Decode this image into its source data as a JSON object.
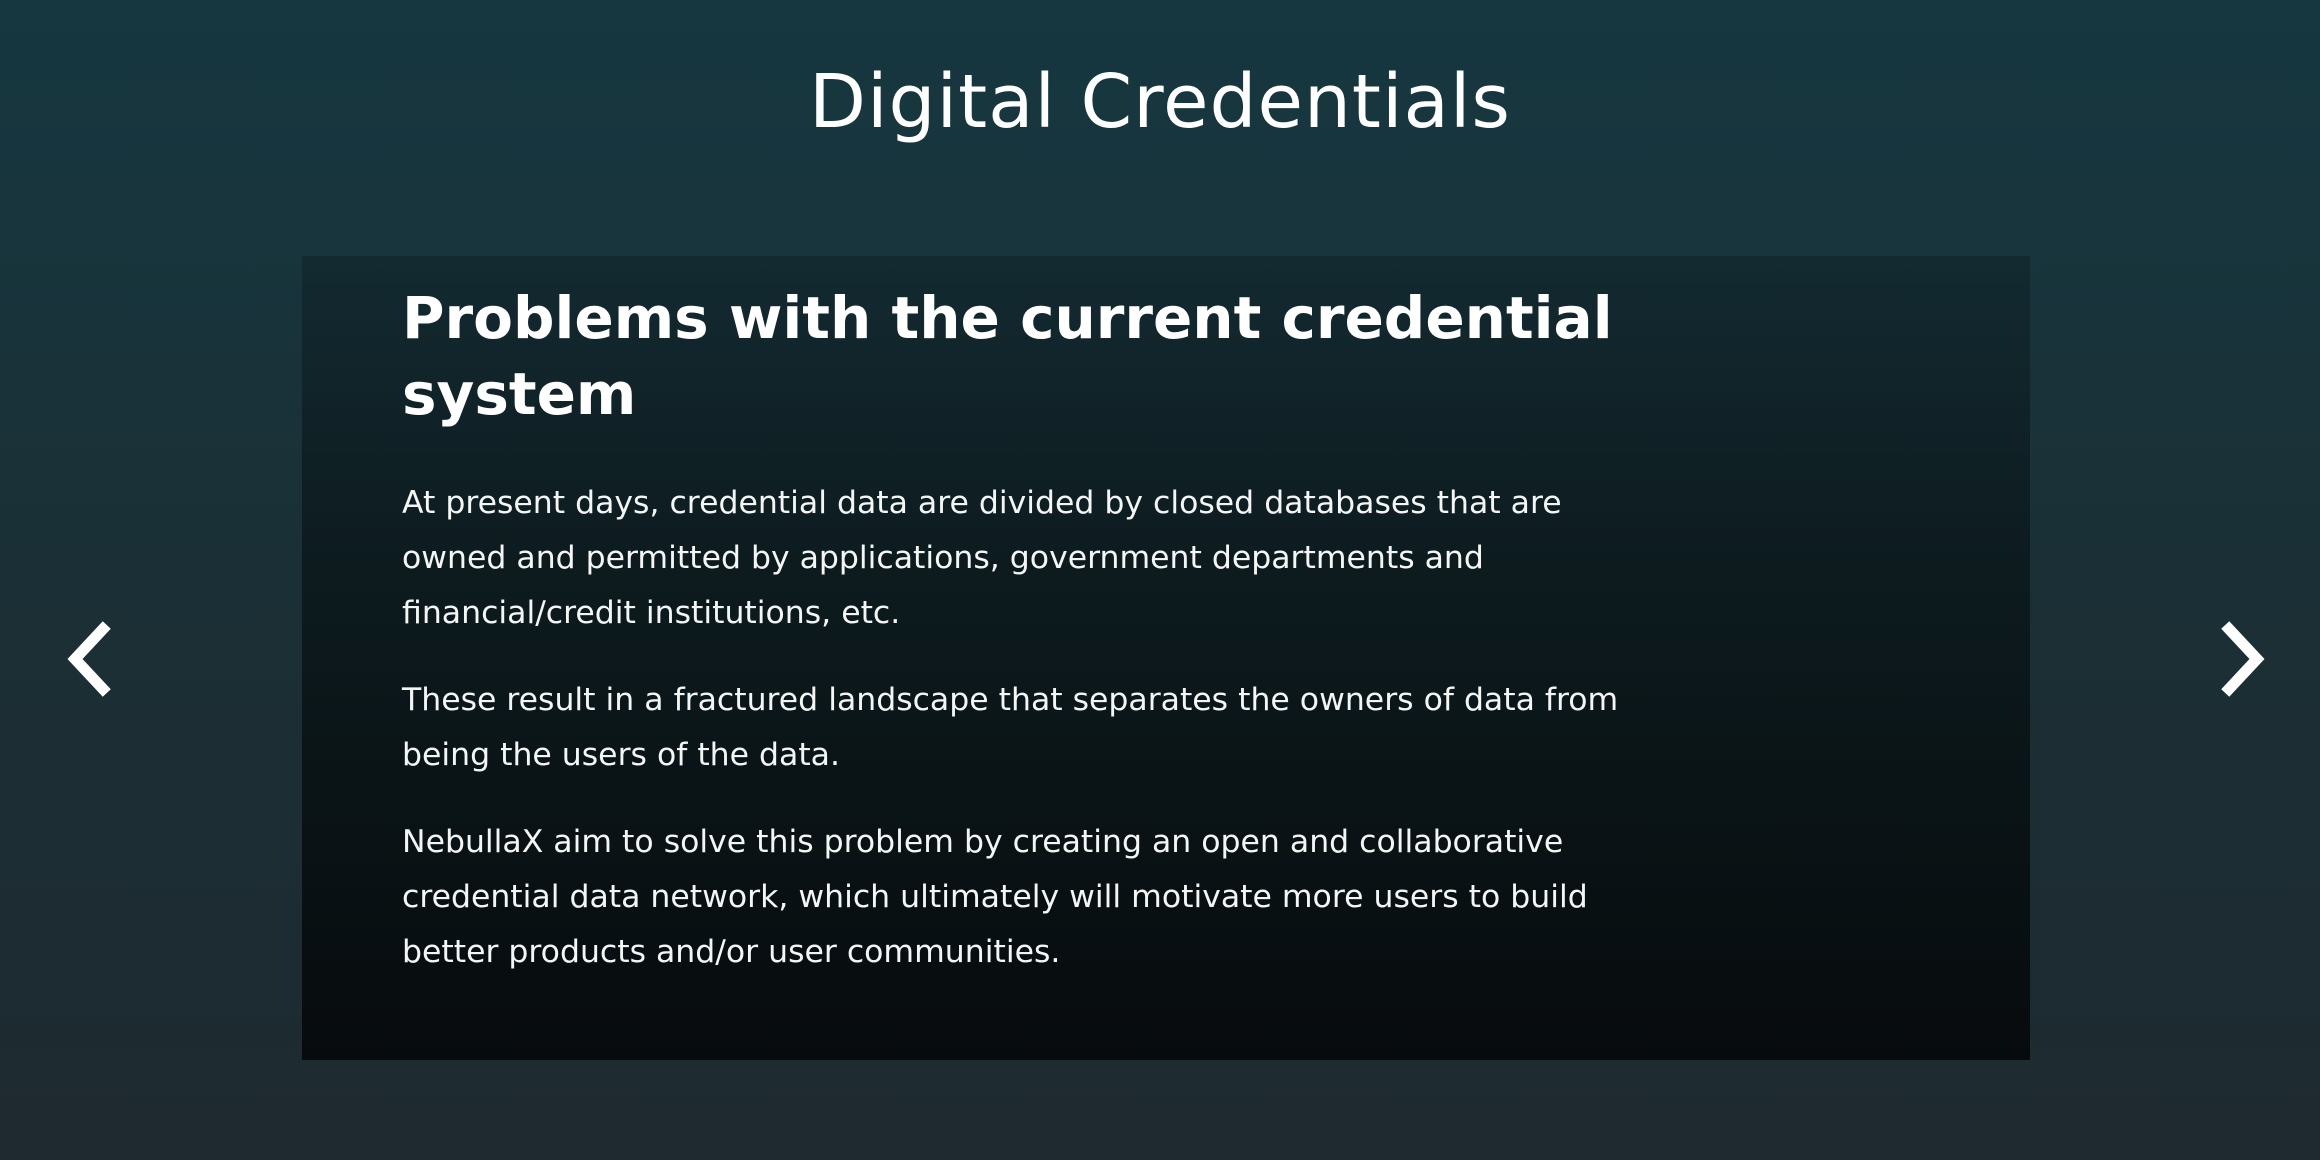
{
  "page": {
    "title": "Digital Credentials"
  },
  "slide": {
    "heading": "Problems with the current credential system",
    "paragraphs": [
      "At present days, credential data are divided by closed databases that are owned and permitted by applications, government departments and financial/credit institutions, etc.",
      "These result in a fractured landscape that separates the owners of data from being the users of the data.",
      "NebullaX aim to solve this problem by creating an open and collaborative credential data network, which ultimately will motivate more users to build better products and/or user communities."
    ]
  },
  "navigation": {
    "prev_icon": "chevron-left-icon",
    "next_icon": "chevron-right-icon"
  },
  "colors": {
    "background": "#173740",
    "card": "#0a1316",
    "text": "#ffffff"
  }
}
